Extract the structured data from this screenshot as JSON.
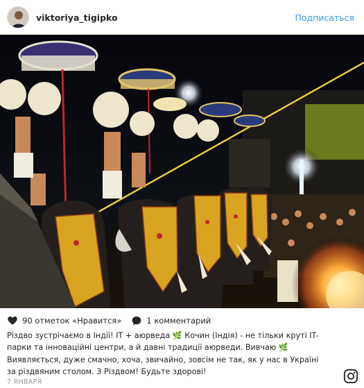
{
  "post": {
    "username": "viktoriya_tigipko",
    "follow_label": "Подписаться",
    "likes_text": "90 отметок «Нравится»",
    "comments_text": "1 комментарий",
    "caption": "Різдво зустрічаємо в Індії! IT + аюрведа 🌿 Кочин (Індія) - не тільки круті IT-парки та інноваційні центри, а й давні традиції аюрведи. Вивчаю 🌿 Виявляється, дуже смачно, хоча, звичайно, зовсім не так, як у нас в Україні за різдвяним столом. З Різдвом! Будьте здорові!",
    "date": "7 ЯНВАРЯ"
  },
  "icons": {
    "heart": "heart-icon",
    "comment": "comment-bubble-icon",
    "instagram": "instagram-logo-icon"
  },
  "colors": {
    "link": "#3897f0",
    "text": "#262626",
    "muted": "#999999",
    "photo_sky": "#07070f",
    "elephant_caparison_gold": "#d9a520",
    "fire_orange": "#ff8a1e"
  }
}
